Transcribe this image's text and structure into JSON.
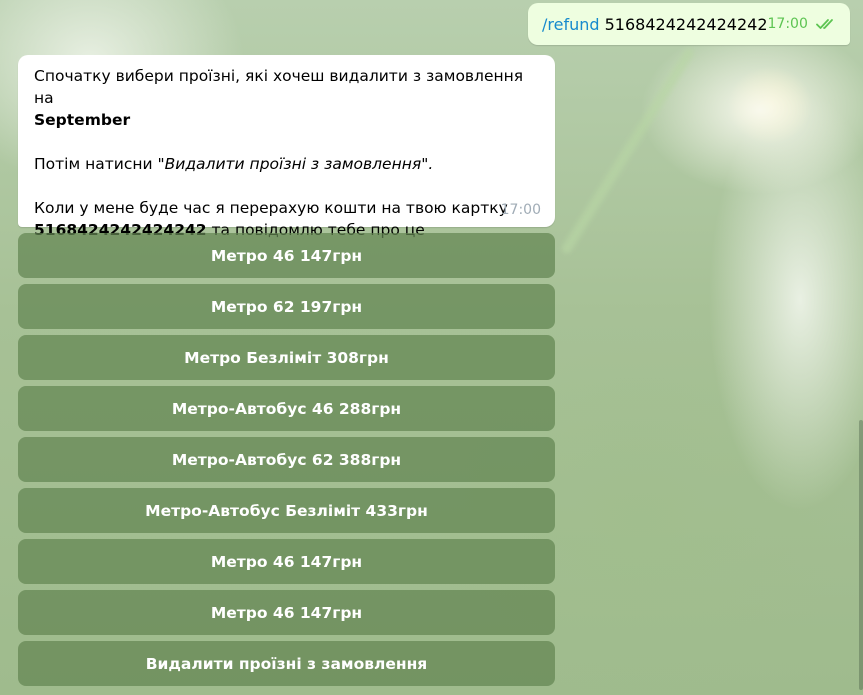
{
  "outgoing": {
    "command": "/refund",
    "argument": "5168424242424242",
    "time": "17:00",
    "status_icon": "double-check-icon"
  },
  "incoming": {
    "line1_prefix": "Спочатку вибери проїзні, які хочеш видалити з замовлення на",
    "line1_month": "September",
    "line2_prefix": "Потім натисни ",
    "line2_quote": "\"Видалити проїзні з замовлення\".",
    "line3_text": "Коли у мене буде час я перерахую кошти на твою картку",
    "line3_card": "5168424242424242",
    "line3_suffix": " та повідомлю тебе про це",
    "time": "17:00"
  },
  "keyboard": {
    "buttons": [
      "Метро 46 147грн",
      "Метро 62 197грн",
      "Метро Безліміт 308грн",
      "Метро-Автобус 46 288грн",
      "Метро-Автобус 62 388грн",
      "Метро-Автобус Безліміт 433грн",
      "Метро 46 147грн",
      "Метро 46 147грн",
      "Видалити проїзні з замовлення"
    ]
  },
  "colors": {
    "outgoing_bubble": "#eefee0",
    "link": "#168acd",
    "check": "#5dc452",
    "button_bg": "#628552"
  }
}
